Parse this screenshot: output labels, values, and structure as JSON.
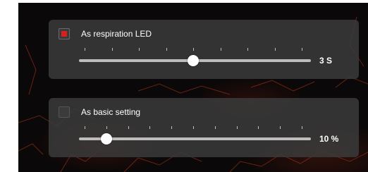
{
  "led_settings": {
    "respiration": {
      "label": "As respiration LED",
      "checked": true,
      "slider": {
        "min": 1,
        "max": 5,
        "value": 3,
        "display": "3 S"
      },
      "tick_count": 9
    },
    "basic": {
      "label": "As basic setting",
      "checked": false,
      "slider": {
        "min": 0,
        "max": 100,
        "value": 10,
        "display": "10 %"
      },
      "tick_count": 11
    }
  },
  "colors": {
    "checked_mark": "#d81e1e",
    "track": "#bdbdbd",
    "thumb": "#ffffff",
    "panel": "#3a3a3a"
  }
}
